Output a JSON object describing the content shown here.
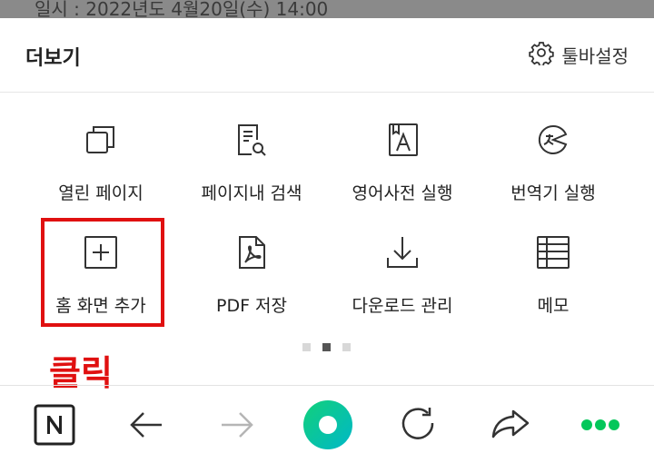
{
  "background_text": "일시 : 2022년도 4월20일(수) 14:00",
  "panel": {
    "title": "더보기",
    "toolbar_settings_label": "툴바설정"
  },
  "menu_items": [
    {
      "label": "열린 페이지",
      "icon": "open-pages-icon"
    },
    {
      "label": "페이지내 검색",
      "icon": "find-in-page-icon"
    },
    {
      "label": "영어사전 실행",
      "icon": "english-dictionary-icon"
    },
    {
      "label": "번역기 실행",
      "icon": "translator-icon"
    },
    {
      "label": "홈 화면 추가",
      "icon": "add-to-home-icon"
    },
    {
      "label": "PDF 저장",
      "icon": "pdf-save-icon"
    },
    {
      "label": "다운로드 관리",
      "icon": "download-icon"
    },
    {
      "label": "메모",
      "icon": "memo-icon"
    }
  ],
  "pagination": {
    "pages": 3,
    "current": 2
  },
  "annotation": {
    "text": "클릭",
    "color": "#e01010"
  },
  "bottom_bar": [
    "naver-home-icon",
    "back-arrow-icon",
    "forward-arrow-icon",
    "green-dot-home-icon",
    "refresh-icon",
    "share-icon",
    "more-icon"
  ],
  "colors": {
    "accent_green": "#03c75a",
    "highlight_red": "#e01010"
  }
}
